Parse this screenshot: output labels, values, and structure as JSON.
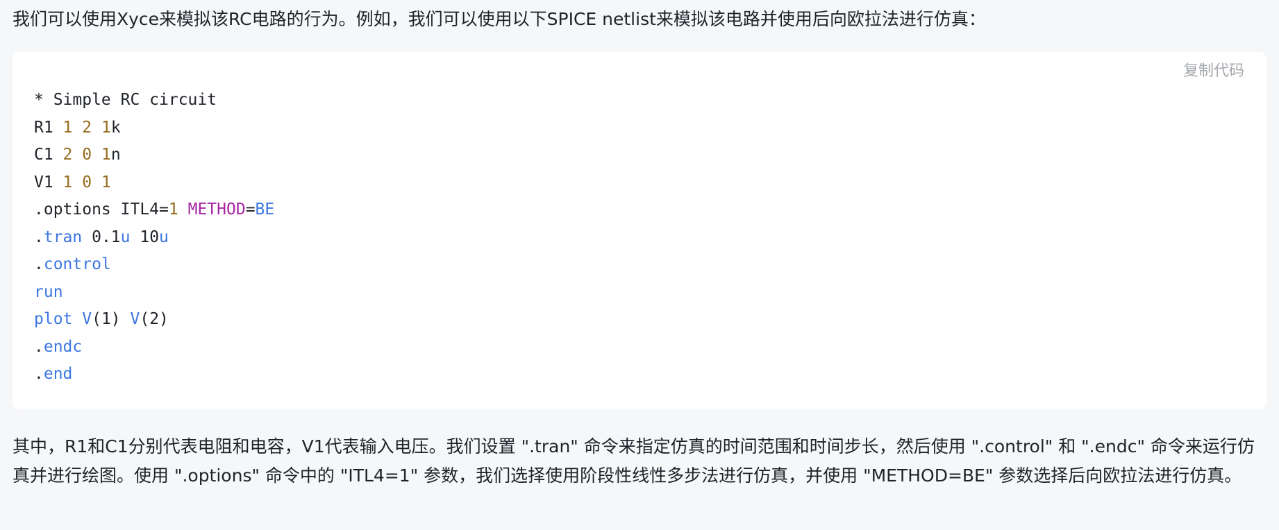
{
  "intro_text": "我们可以使用Xyce来模拟该RC电路的行为。例如，我们可以使用以下SPICE netlist来模拟该电路并使用后向欧拉法进行仿真：",
  "code_block": {
    "copy_label": "复制代码",
    "lines": [
      [
        [
          "plain",
          "* Simple RC circuit"
        ]
      ],
      [
        [
          "plain",
          "R1 "
        ],
        [
          "num",
          "1"
        ],
        [
          "plain",
          " "
        ],
        [
          "num",
          "2"
        ],
        [
          "plain",
          " "
        ],
        [
          "num",
          "1"
        ],
        [
          "plain",
          "k"
        ]
      ],
      [
        [
          "plain",
          "C1 "
        ],
        [
          "num",
          "2"
        ],
        [
          "plain",
          " "
        ],
        [
          "num",
          "0"
        ],
        [
          "plain",
          " "
        ],
        [
          "num",
          "1"
        ],
        [
          "plain",
          "n"
        ]
      ],
      [
        [
          "plain",
          "V1 "
        ],
        [
          "num",
          "1"
        ],
        [
          "plain",
          " "
        ],
        [
          "num",
          "0"
        ],
        [
          "plain",
          " "
        ],
        [
          "num",
          "1"
        ]
      ],
      [
        [
          "plain",
          ".options ITL4="
        ],
        [
          "num",
          "1"
        ],
        [
          "plain",
          " "
        ],
        [
          "attr",
          "METHOD"
        ],
        [
          "plain",
          "="
        ],
        [
          "kw",
          "BE"
        ]
      ],
      [
        [
          "plain",
          "."
        ],
        [
          "kw",
          "tran"
        ],
        [
          "plain",
          " 0.1"
        ],
        [
          "kw",
          "u"
        ],
        [
          "plain",
          " 10"
        ],
        [
          "kw",
          "u"
        ]
      ],
      [
        [
          "plain",
          "."
        ],
        [
          "kw",
          "control"
        ]
      ],
      [
        [
          "kw",
          "run"
        ]
      ],
      [
        [
          "kw",
          "plot"
        ],
        [
          "plain",
          " "
        ],
        [
          "kw",
          "V"
        ],
        [
          "plain",
          "(1) "
        ],
        [
          "kw",
          "V"
        ],
        [
          "plain",
          "(2)"
        ]
      ],
      [
        [
          "plain",
          "."
        ],
        [
          "kw",
          "endc"
        ]
      ],
      [
        [
          "plain",
          "."
        ],
        [
          "kw",
          "end"
        ]
      ]
    ]
  },
  "outro_text": "其中，R1和C1分别代表电阻和电容，V1代表输入电压。我们设置 \".tran\" 命令来指定仿真的时间范围和时间步长，然后使用 \".control\" 和 \".endc\" 命令来运行仿真并进行绘图。使用 \".options\" 命令中的 \"ITL4=1\" 参数，我们选择使用阶段性线性多步法进行仿真，并使用 \"METHOD=BE\" 参数选择后向欧拉法进行仿真。",
  "token_colors": {
    "plain": "#1f2329",
    "num": "#956b1e",
    "kw": "#3b76e1",
    "attr": "#a626a4"
  }
}
